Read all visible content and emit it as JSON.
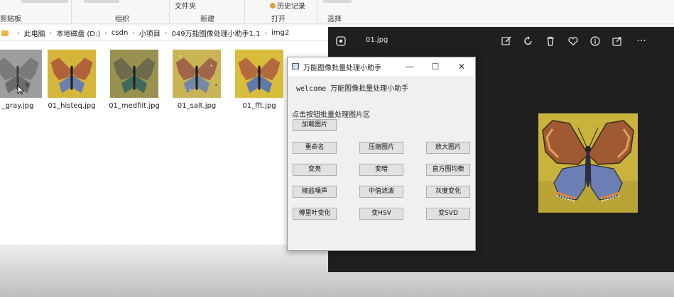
{
  "ribbon": {
    "clipboard_label": "剪贴板",
    "organize_label": "组织",
    "new_label": "新建",
    "open_label": "打开",
    "select_label": "选择",
    "new_folder_label": "文件夹",
    "history_label": "历史记录"
  },
  "address": {
    "crumbs": [
      "此电脑",
      "本地磁盘 (D:)",
      "csdn",
      "小项目",
      "049万能图像处理小助手1.1",
      "img2"
    ]
  },
  "files": [
    {
      "name": "_gray.jpg",
      "style": "gray"
    },
    {
      "name": "01_histeq.jpg",
      "style": "histeq"
    },
    {
      "name": "01_medfilt.jpg",
      "style": "medfilt"
    },
    {
      "name": "01_salt.jpg",
      "style": "salt"
    },
    {
      "name": "01_fft.jpg",
      "style": "fft"
    }
  ],
  "viewer": {
    "filename": "01.jpg",
    "more_label": "···"
  },
  "dialog": {
    "title": "万能图像批量处理小助手",
    "welcome": "welcome 万能图像批量处理小助手",
    "area_label": "点击按钮批量处理图片区",
    "load_button": "加载图片",
    "buttons": [
      "重命名",
      "压缩图片",
      "放大图片",
      "变亮",
      "变暗",
      "直方图均衡",
      "椒盐噪声",
      "中值滤波",
      "灰度变化",
      "傅里叶变化",
      "变HSV",
      "变SVD"
    ]
  },
  "colors": {
    "viewer_bg": "#1f1f1f",
    "folder": "#e8b74a"
  }
}
